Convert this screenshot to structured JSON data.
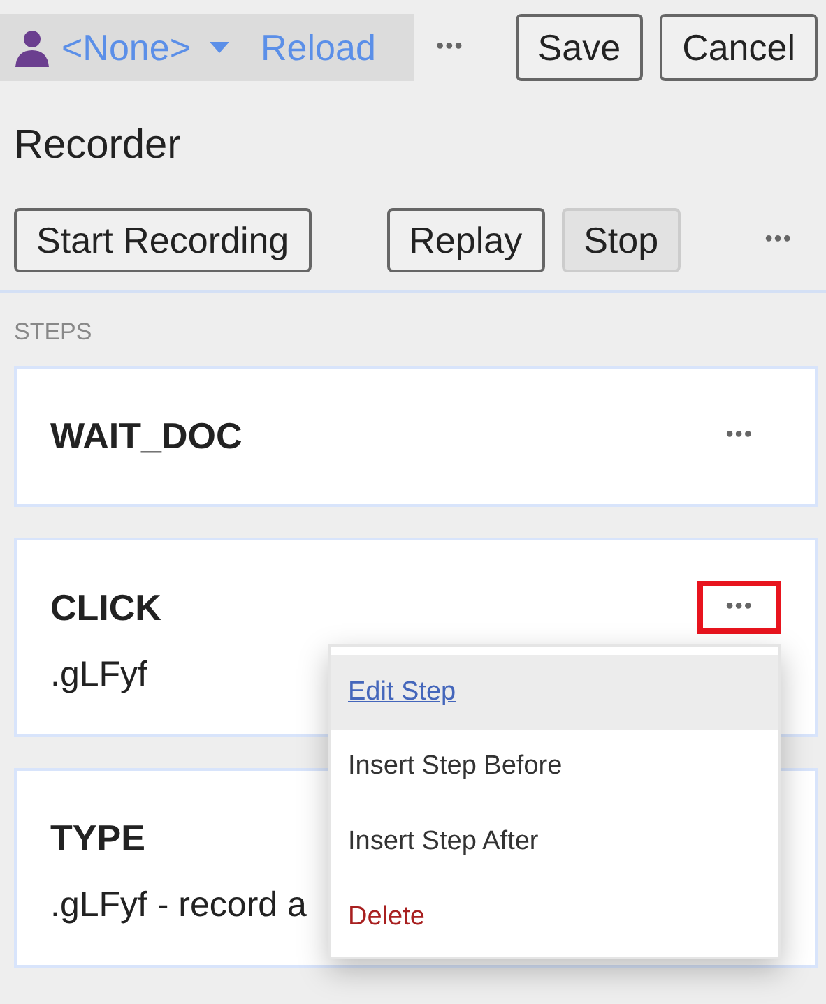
{
  "toolbar": {
    "profile": "<None>",
    "reload": "Reload",
    "more": "•••",
    "buttons": [
      "Save",
      "Cancel"
    ]
  },
  "title": "Recorder",
  "actions": [
    {
      "label": "Start Recording",
      "disabled": false
    },
    {
      "label": "Replay",
      "disabled": false
    },
    {
      "label": "Stop",
      "disabled": true
    }
  ],
  "actions_more": "•••",
  "steps_heading": "STEPS",
  "steps": [
    {
      "name": "WAIT_DOC",
      "highlighted": false
    },
    {
      "name": "CLICK",
      "detail": ".gLFyf",
      "highlighted": true,
      "menu": [
        {
          "label": "Edit Step",
          "kind": "link",
          "selected": true
        },
        {
          "label": "Insert Step Before",
          "kind": "normal",
          "selected": false
        },
        {
          "label": "Insert Step After",
          "kind": "normal",
          "selected": false
        },
        {
          "label": "Delete",
          "kind": "danger",
          "selected": false
        }
      ]
    },
    {
      "name": "TYPE",
      "detail": ".gLFyf - record a"
    }
  ],
  "step_more": "•••"
}
